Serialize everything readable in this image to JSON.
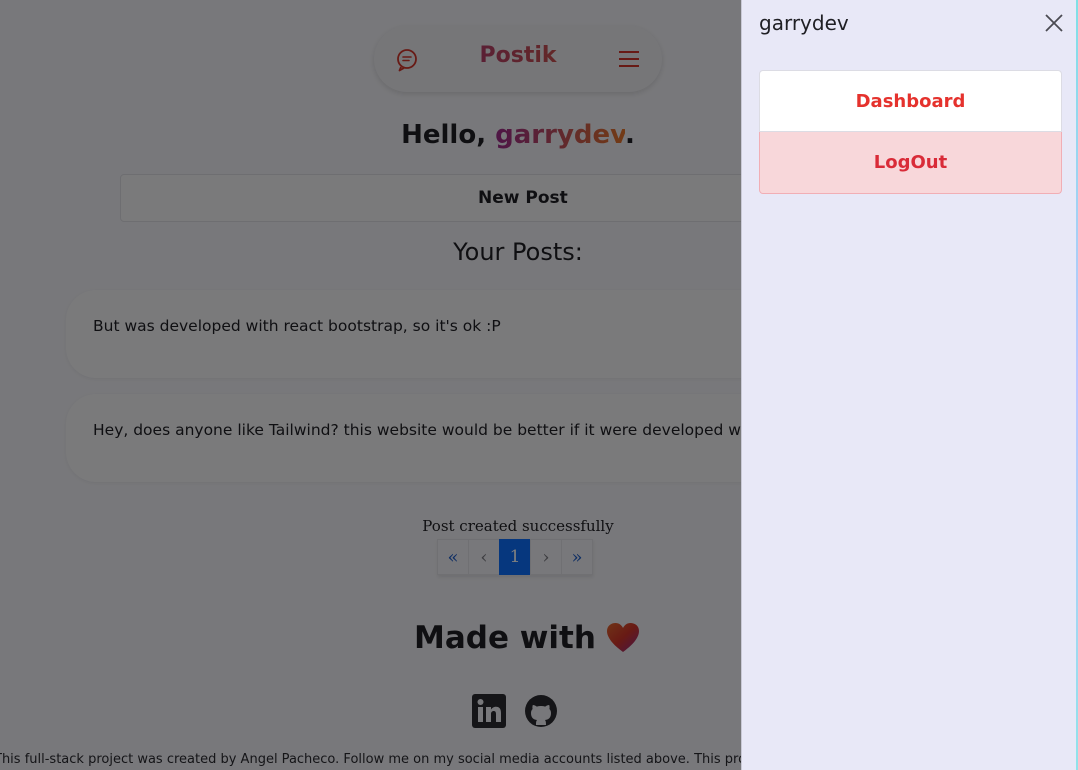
{
  "navbar": {
    "brand": "Postik",
    "chat_icon": "chat-bubble-icon",
    "menu_icon": "hamburger-menu-icon"
  },
  "greeting": {
    "prefix": "Hello, ",
    "username": "garrydev",
    "suffix": "."
  },
  "new_post_label": "New Post",
  "posts_heading": "Your Posts:",
  "posts": [
    {
      "text": "But was developed with react bootstrap, so it's ok :P"
    },
    {
      "text": "Hey, does anyone like Tailwind? this website would be better if it were developed with Tailwind"
    }
  ],
  "flash_message": "Post created successfully",
  "pagination": {
    "first": "«",
    "prev": "‹",
    "current": "1",
    "next": "›",
    "last": "»"
  },
  "made_with": "Made with",
  "social_icons": [
    "linkedin-icon",
    "github-icon"
  ],
  "footer_text": "This full-stack project was created by Angel Pacheco. Follow me on my social media accounts listed above. This project is licensed",
  "offcanvas": {
    "title": "garrydev",
    "items": [
      {
        "label": "Dashboard"
      },
      {
        "label": "LogOut"
      }
    ]
  },
  "colors": {
    "brand_gradient_start": "#9c2a8c",
    "brand_gradient_end": "#e0662e",
    "accent_red": "#e5322d",
    "pagination_active": "#0d6efd",
    "offcanvas_bg": "#e8e8f7"
  }
}
